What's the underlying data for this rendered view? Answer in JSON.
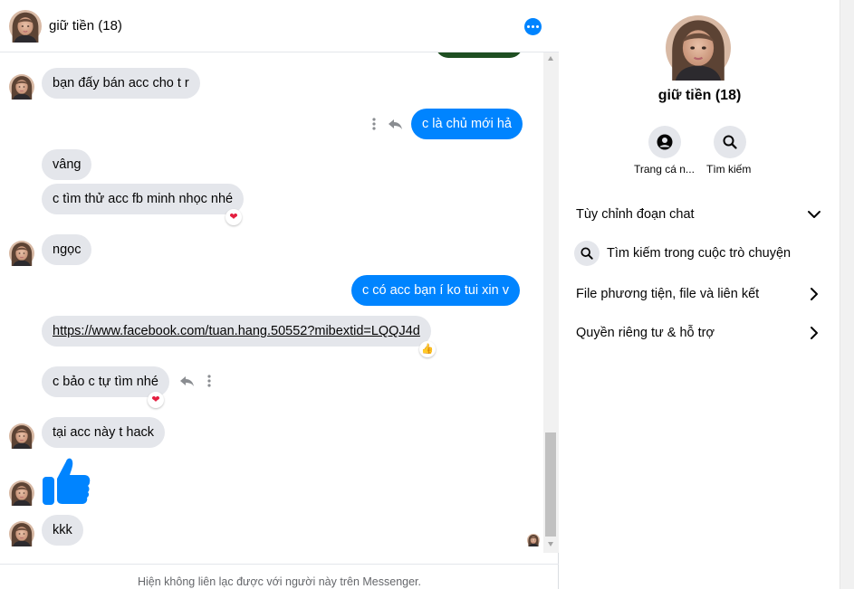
{
  "conversation": {
    "title": "giữ tiền (18)"
  },
  "messages": {
    "m1": "bạn đấy bán acc cho t r",
    "m2": "c là chủ mới hả",
    "m3": "vâng",
    "m4": "c tìm thử acc fb minh nhọc nhé",
    "m5": "ngọc",
    "m6": "c có acc bạn í ko tui xin v",
    "m7": "https://www.facebook.com/tuan.hang.50552?mibextid=LQQJ4d",
    "m8": "c bảo c tự tìm nhé",
    "m9": "tại acc này t hack",
    "m10": "kkk"
  },
  "reactions": {
    "heart": "❤",
    "thumbs": "👍"
  },
  "footer": {
    "notice": "Hiện không liên lạc được với người này trên Messenger."
  },
  "info_panel": {
    "name": "giữ tiền (18)",
    "profile_label": "Trang cá n...",
    "search_label": "Tìm kiếm",
    "menu": {
      "customize": "Tùy chỉnh đoạn chat",
      "search_conversation": "Tìm kiếm trong cuộc trò chuyện",
      "media": "File phương tiện, file và liên kết",
      "privacy": "Quyền riêng tư & hỗ trợ"
    }
  },
  "colors": {
    "accent": "#0084ff",
    "incoming_bubble": "#e4e6eb",
    "reaction_heart": "#e41e3f"
  }
}
